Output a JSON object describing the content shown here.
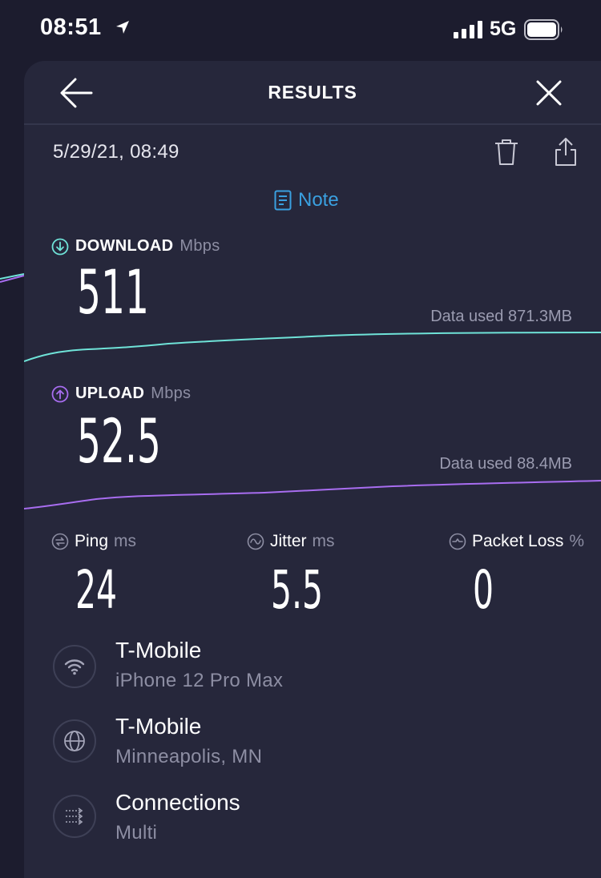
{
  "status_bar": {
    "time": "08:51",
    "network": "5G",
    "icons": [
      "location-arrow-icon",
      "signal-bars-icon",
      "battery-icon"
    ]
  },
  "header": {
    "title": "RESULTS",
    "icons": [
      "back-arrow-icon",
      "close-icon"
    ]
  },
  "result": {
    "date": "5/29/21, 08:49",
    "actions": [
      "trash-icon",
      "share-icon"
    ],
    "note_label": "Note"
  },
  "download": {
    "label": "DOWNLOAD",
    "unit": "Mbps",
    "value": "511",
    "data_used": "Data used 871.3MB",
    "color": "#6fe3d8"
  },
  "upload": {
    "label": "UPLOAD",
    "unit": "Mbps",
    "value": "52.5",
    "data_used": "Data used 88.4MB",
    "color": "#a86df0"
  },
  "stats": {
    "ping": {
      "label": "Ping",
      "unit": "ms",
      "value": "24"
    },
    "jitter": {
      "label": "Jitter",
      "unit": "ms",
      "value": "5.5"
    },
    "packet_loss": {
      "label": "Packet Loss",
      "unit": "%",
      "value": "0"
    }
  },
  "info": [
    {
      "icon": "wifi-icon",
      "title": "T-Mobile",
      "subtitle": "iPhone 12 Pro Max"
    },
    {
      "icon": "globe-icon",
      "title": "T-Mobile",
      "subtitle": "Minneapolis, MN"
    },
    {
      "icon": "connections-icon",
      "title": "Connections",
      "subtitle": "Multi"
    }
  ],
  "colors": {
    "background": "#1c1c2e",
    "sheet": "#26273b",
    "accent_link": "#3aa0e0",
    "muted_text": "#8d8ea3"
  }
}
